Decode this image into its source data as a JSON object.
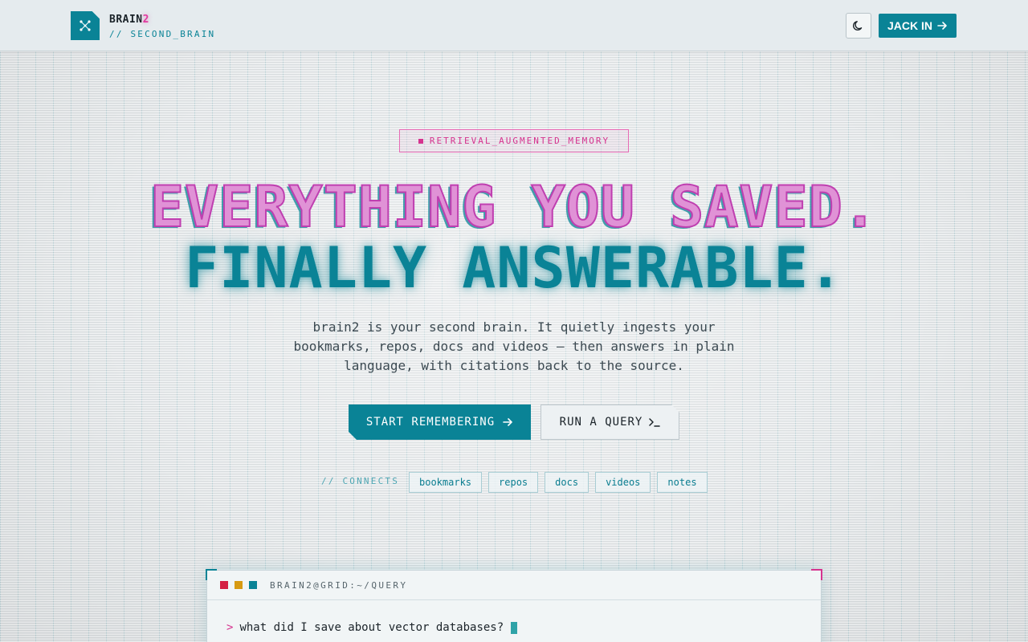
{
  "header": {
    "brand_name": "BRAIN",
    "brand_accent": "2",
    "brand_sub": "// SECOND_BRAIN",
    "logo_icon": "network-nodes-icon",
    "theme_toggle_icon": "moon-icon",
    "cta_label": "JACK IN",
    "cta_icon": "arrow-right-icon"
  },
  "hero": {
    "badge": "RETRIEVAL_AUGMENTED_MEMORY",
    "headline_line1": "EVERYTHING YOU SAVED.",
    "headline_line2": "FINALLY ANSWERABLE.",
    "tagline": "brain2 is your second brain. It quietly ingests your bookmarks, repos, docs and videos — then answers in plain language, with citations back to the source.",
    "primary_cta": "START REMEMBERING",
    "secondary_cta": "RUN A QUERY",
    "secondary_cta_icon": "terminal-prompt-icon",
    "connects_label": "// CONNECTS",
    "sources": [
      "bookmarks",
      "repos",
      "docs",
      "videos",
      "notes"
    ]
  },
  "terminal": {
    "title": "BRAIN2@GRID:~/QUERY",
    "prompt_symbol": ">",
    "query": "what did I save about vector databases?"
  },
  "colors": {
    "accent_teal": "#0a8396",
    "accent_magenta": "#d6338f",
    "dot_red": "#d41f43",
    "dot_amber": "#d79a12",
    "background": "#e3e7e9"
  }
}
